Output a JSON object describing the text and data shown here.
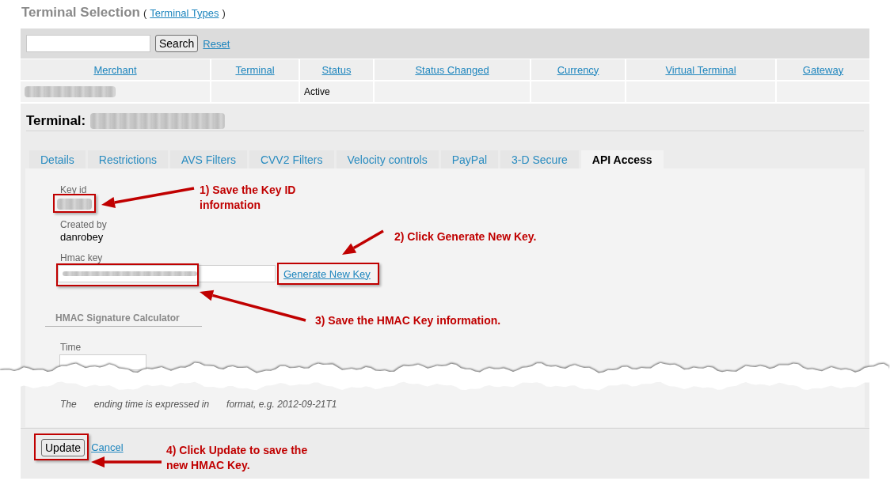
{
  "header": {
    "title": "Terminal Selection",
    "open_paren": "(",
    "link": "Terminal Types",
    "close_paren": ")"
  },
  "search": {
    "button": "Search",
    "reset": "Reset"
  },
  "table": {
    "columns": [
      "Merchant",
      "Terminal",
      "Status",
      "Status Changed",
      "Currency",
      "Virtual Terminal",
      "Gateway"
    ],
    "rows": [
      {
        "cells": [
          {
            "kind": "blurred"
          },
          {
            "kind": "empty"
          },
          {
            "kind": "text",
            "text": "Active"
          },
          {
            "kind": "empty"
          },
          {
            "kind": "empty"
          },
          {
            "kind": "empty"
          },
          {
            "kind": "empty"
          }
        ]
      }
    ]
  },
  "terminal": {
    "label": "Terminal:",
    "value_blurred": true
  },
  "tabs": [
    {
      "label": "Details",
      "selected": false
    },
    {
      "label": "Restrictions",
      "selected": false
    },
    {
      "label": "AVS Filters",
      "selected": false
    },
    {
      "label": "CVV2 Filters",
      "selected": false
    },
    {
      "label": "Velocity controls",
      "selected": false
    },
    {
      "label": "PayPal",
      "selected": false
    },
    {
      "label": "3-D Secure",
      "selected": false
    },
    {
      "label": "API Access",
      "selected": true
    }
  ],
  "api_access": {
    "key_id": {
      "label": "Key id",
      "value_blurred": true
    },
    "created_by": {
      "label": "Created by",
      "value": "danrobey"
    },
    "hmac_key": {
      "label": "Hmac key",
      "value_blurred": true,
      "action": "Generate New Key"
    },
    "calculator": {
      "heading": "HMAC Signature Calculator",
      "time_label": "Time",
      "note_fragments": [
        "The",
        "ending time is expressed in",
        "format, e.g. 2012-09-21T1"
      ]
    }
  },
  "footer": {
    "update": "Update",
    "cancel": "Cancel"
  },
  "annotations": [
    {
      "text": "1) Save the Key ID information"
    },
    {
      "text": "2) Click Generate New Key."
    },
    {
      "text": "3) Save the HMAC Key information."
    },
    {
      "text": "4) Click Update to save the new HMAC Key."
    }
  ]
}
